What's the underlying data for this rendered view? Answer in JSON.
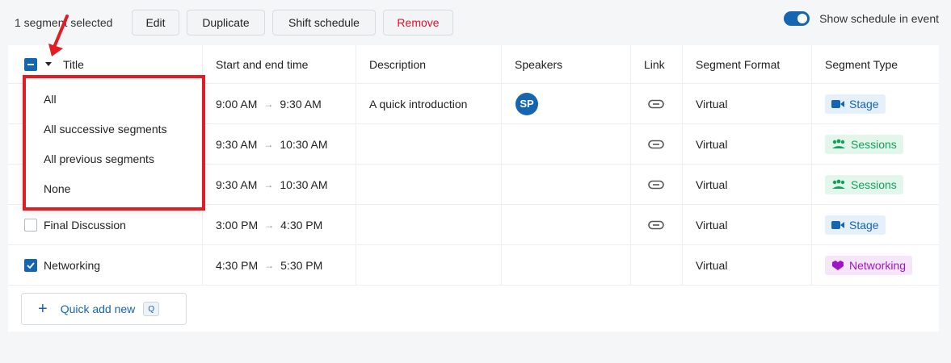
{
  "toolbar": {
    "selection_text": "1 segment selected",
    "edit_label": "Edit",
    "duplicate_label": "Duplicate",
    "shift_label": "Shift schedule",
    "remove_label": "Remove",
    "toggle_label": "Show schedule in event",
    "toggle_on": true
  },
  "table": {
    "headers": {
      "title": "Title",
      "time": "Start and end time",
      "description": "Description",
      "speakers": "Speakers",
      "link": "Link",
      "format": "Segment Format",
      "type": "Segment Type"
    },
    "rows": [
      {
        "title": "",
        "start": "9:00 AM",
        "end": "9:30 AM",
        "description": "A quick introduction",
        "speaker": "SP",
        "format": "Virtual",
        "type": "Stage",
        "type_kind": "stage",
        "link": true,
        "checked": false
      },
      {
        "title": "",
        "start": "9:30 AM",
        "end": "10:30 AM",
        "description": "",
        "speaker": "",
        "format": "Virtual",
        "type": "Sessions",
        "type_kind": "sessions",
        "link": true,
        "checked": false
      },
      {
        "title": "",
        "start": "9:30 AM",
        "end": "10:30 AM",
        "description": "",
        "speaker": "",
        "format": "Virtual",
        "type": "Sessions",
        "type_kind": "sessions",
        "link": true,
        "checked": false
      },
      {
        "title": "Final Discussion",
        "start": "3:00 PM",
        "end": "4:30 PM",
        "description": "",
        "speaker": "",
        "format": "Virtual",
        "type": "Stage",
        "type_kind": "stage",
        "link": true,
        "checked": false
      },
      {
        "title": "Networking",
        "start": "4:30 PM",
        "end": "5:30 PM",
        "description": "",
        "speaker": "",
        "format": "Virtual",
        "type": "Networking",
        "type_kind": "networking",
        "link": false,
        "checked": true
      }
    ]
  },
  "select_menu": {
    "items": [
      "All",
      "All successive segments",
      "All previous segments",
      "None"
    ]
  },
  "quick_add": {
    "label": "Quick add new",
    "shortcut": "Q"
  },
  "colors": {
    "accent": "#1565b0",
    "remove": "#e0102a",
    "annotation": "#e31b23"
  }
}
